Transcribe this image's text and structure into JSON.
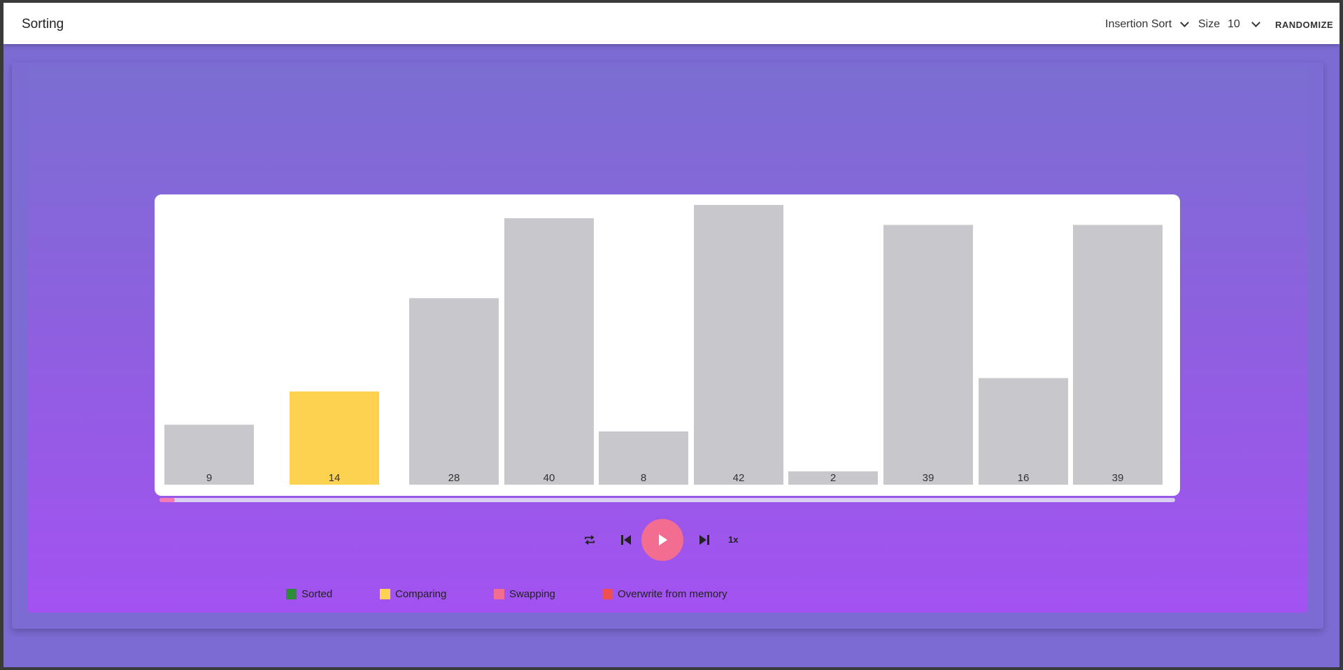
{
  "app": {
    "title": "Sorting"
  },
  "toolbar": {
    "algorithm": "Insertion Sort",
    "size_label": "Size",
    "size_value": "10",
    "randomize_label": "RANDOMIZE"
  },
  "player": {
    "speed_label": "1x",
    "progress": 0.015
  },
  "legend": [
    {
      "label": "Sorted",
      "color": "#2e8b3a"
    },
    {
      "label": "Comparing",
      "color": "#fdd250"
    },
    {
      "label": "Swapping",
      "color": "#f26d8f"
    },
    {
      "label": "Overwrite from memory",
      "color": "#ef4f4f"
    }
  ],
  "colors": {
    "default_bar": "#c8c7cb",
    "comparing_bar": "#fdd250",
    "play_button": "#f26d8f",
    "accent": "#a352f1"
  },
  "chart_data": {
    "type": "bar",
    "categories": [
      "9",
      "14",
      "28",
      "40",
      "8",
      "42",
      "2",
      "39",
      "16",
      "39"
    ],
    "values": [
      9,
      14,
      28,
      40,
      8,
      42,
      2,
      39,
      16,
      39
    ],
    "states": [
      "default",
      "comparing",
      "default",
      "default",
      "default",
      "default",
      "default",
      "default",
      "default",
      "default"
    ],
    "ylim": [
      0,
      42
    ]
  }
}
